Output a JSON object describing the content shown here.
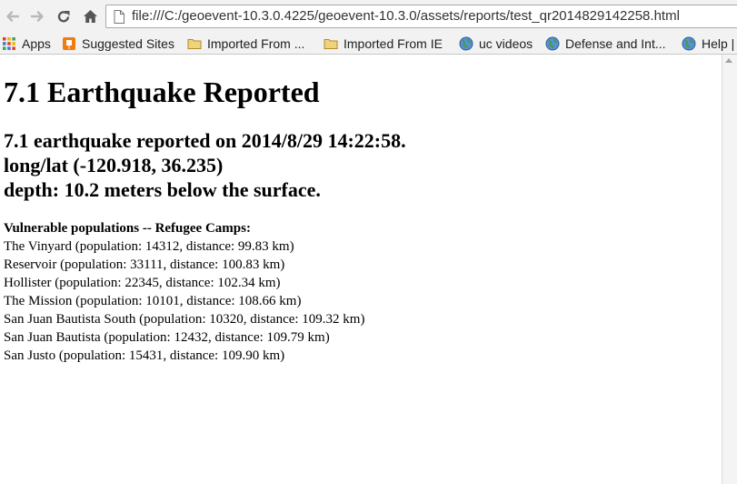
{
  "browser": {
    "url": "file:///C:/geoevent-10.3.0.4225/geoevent-10.3.0/assets/reports/test_qr2014829142258.html",
    "bookmarks": [
      {
        "label": "Apps",
        "icon": "apps-grid-icon"
      },
      {
        "label": "Suggested Sites",
        "icon": "suggested-sites-icon"
      },
      {
        "label": "Imported From ...",
        "icon": "folder-icon"
      },
      {
        "label": "Imported From IE",
        "icon": "folder-icon"
      },
      {
        "label": "uc videos",
        "icon": "globe-icon"
      },
      {
        "label": "Defense and Int...",
        "icon": "globe-icon"
      },
      {
        "label": "Help |",
        "icon": "globe-icon"
      }
    ]
  },
  "page": {
    "title": "7.1 Earthquake Reported",
    "subhead": {
      "line1": "7.1 earthquake reported on 2014/8/29 14:22:58.",
      "line2": "long/lat (-120.918, 36.235)",
      "line3": "depth: 10.2 meters below the surface."
    },
    "vulnerable": {
      "title": "Vulnerable populations -- Refugee Camps:",
      "camps": [
        "The Vinyard (population: 14312, distance: 99.83 km)",
        "Reservoir (population: 33111, distance: 100.83 km)",
        "Hollister (population: 22345, distance: 102.34 km)",
        "The Mission (population: 10101, distance: 108.66 km)",
        "San Juan Bautista South (population: 10320, distance: 109.32 km)",
        "San Juan Bautista (population: 12432, distance: 109.79 km)",
        "San Justo (population: 15431, distance: 109.90 km)"
      ]
    }
  }
}
